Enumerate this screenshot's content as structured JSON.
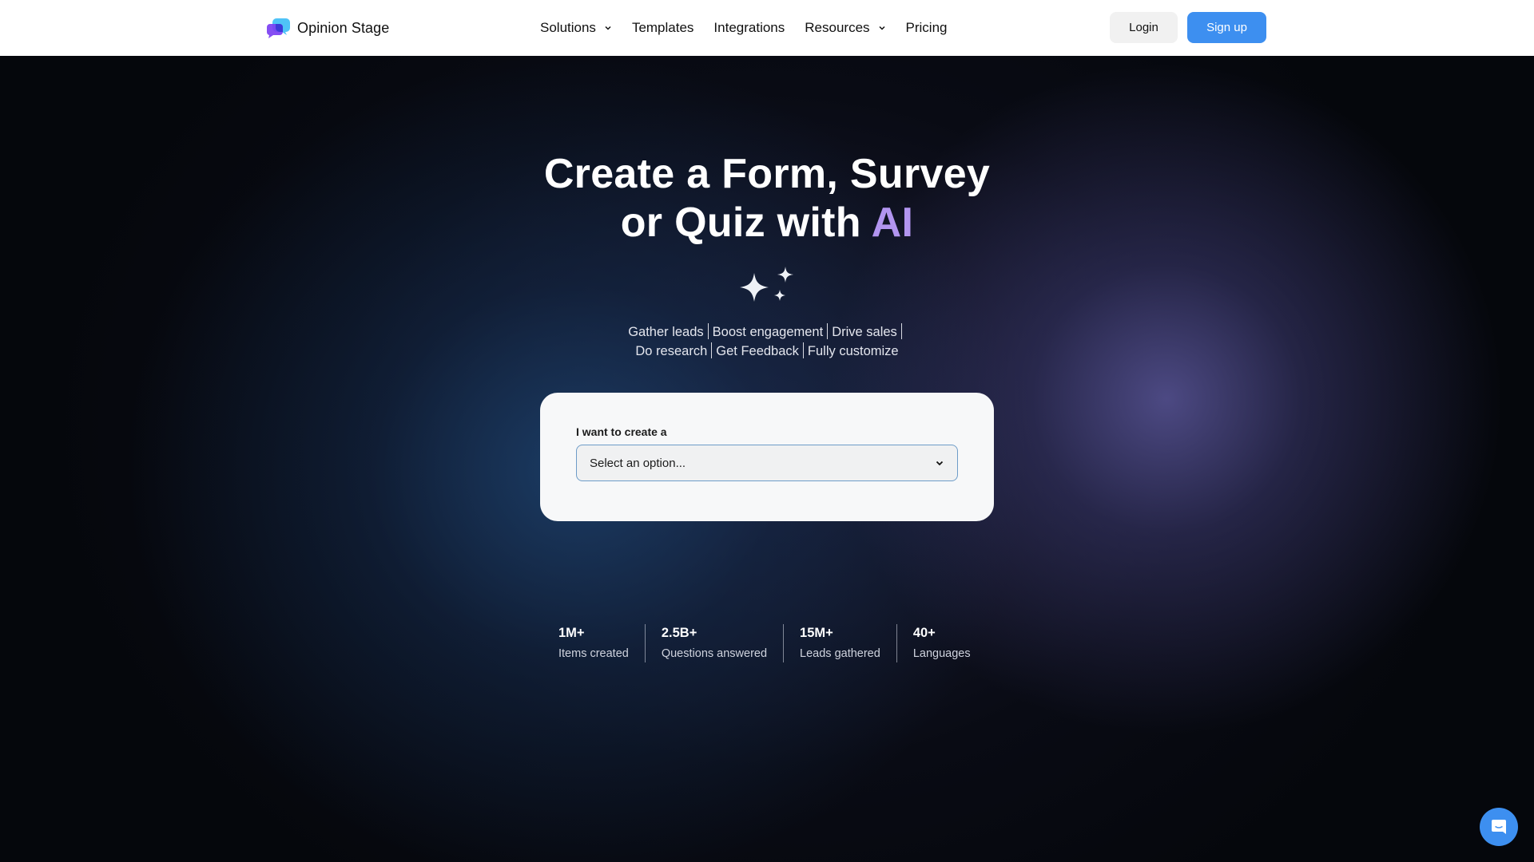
{
  "nav": {
    "brand": "Opinion Stage",
    "links": [
      {
        "label": "Solutions",
        "has_dropdown": true
      },
      {
        "label": "Templates",
        "has_dropdown": false
      },
      {
        "label": "Integrations",
        "has_dropdown": false
      },
      {
        "label": "Resources",
        "has_dropdown": true
      },
      {
        "label": "Pricing",
        "has_dropdown": false
      }
    ],
    "login_label": "Login",
    "signup_label": "Sign up"
  },
  "hero": {
    "headline_line1": "Create a Form, Survey",
    "headline_line2_prefix": "or Quiz with ",
    "headline_highlight": "AI",
    "tagline_items_line1": [
      "Gather leads",
      "Boost engagement",
      "Drive sales"
    ],
    "tagline_items_line2": [
      "Do research",
      "Get Feedback",
      "Fully customize"
    ]
  },
  "form_card": {
    "label": "I want to create a",
    "select_placeholder": "Select an option..."
  },
  "stats": [
    {
      "value": "1M+",
      "label": "Items created"
    },
    {
      "value": "2.5B+",
      "label": "Questions answered"
    },
    {
      "value": "15M+",
      "label": "Leads gathered"
    },
    {
      "value": "40+",
      "label": "Languages"
    }
  ],
  "colors": {
    "accent_blue": "#3d8ff0",
    "ai_highlight": "#b295f0",
    "hero_bg": "#05070c"
  },
  "icons": {
    "sparkles": "sparkles-icon",
    "chat": "chat-icon",
    "chevron": "chevron-down-icon"
  }
}
